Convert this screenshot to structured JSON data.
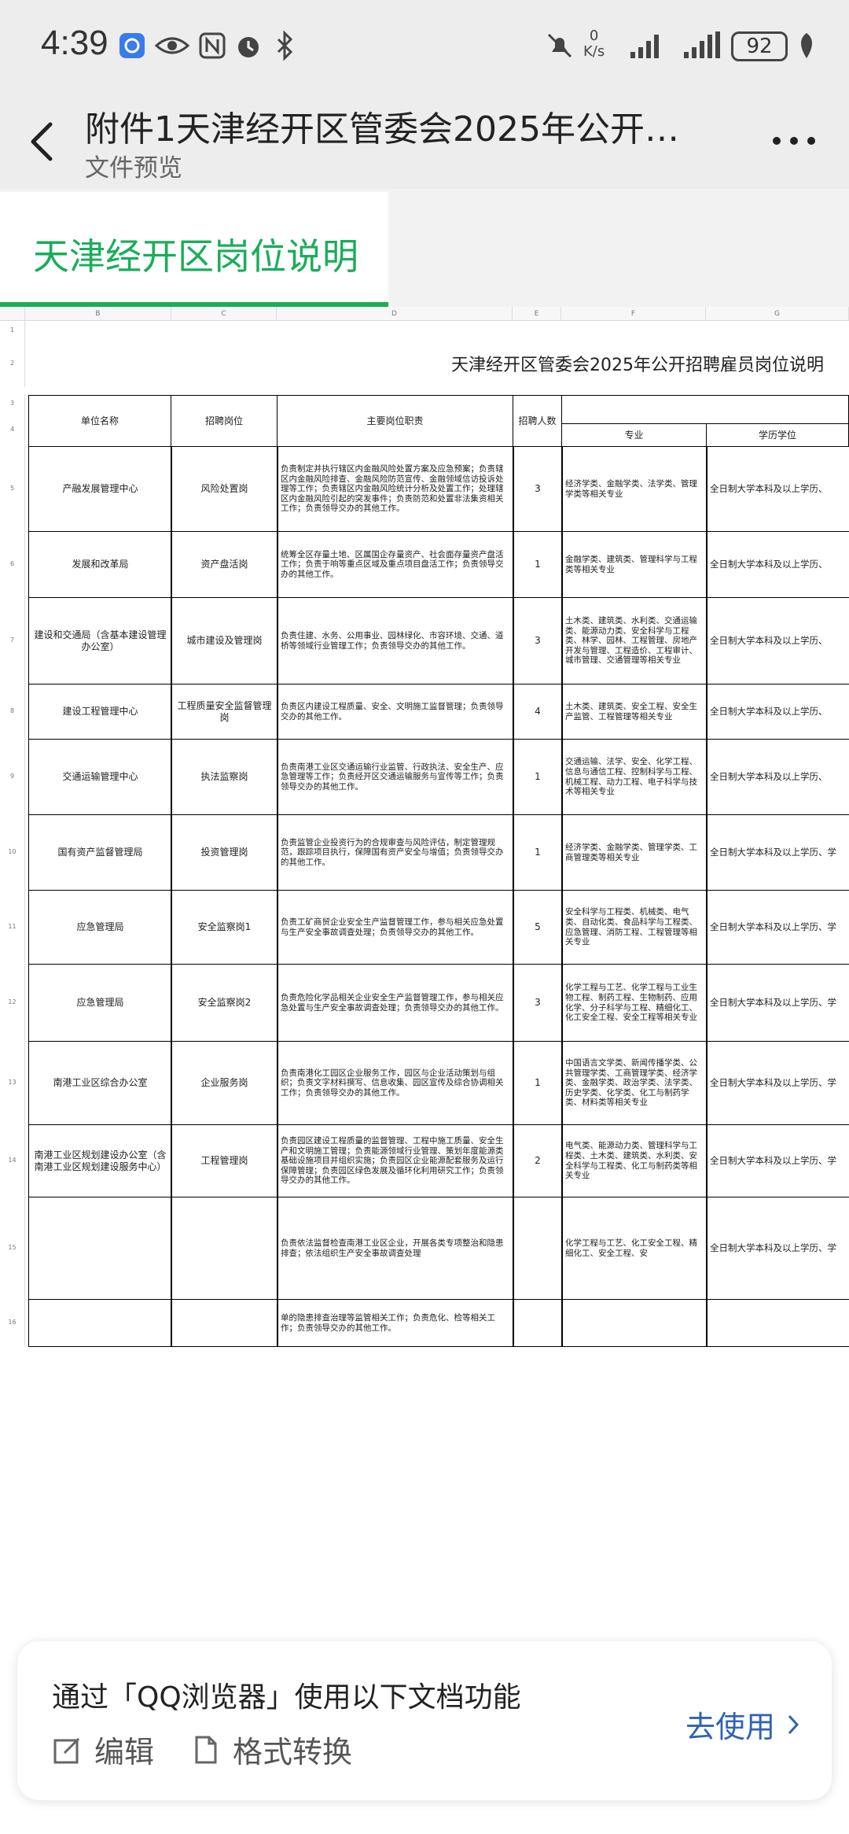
{
  "status_bar": {
    "time": "4:39",
    "net_speed": "0\nK/s",
    "battery": "92"
  },
  "header": {
    "title": "附件1天津经开区管委会2025年公开…",
    "subtitle": "文件预览",
    "more_label": "…"
  },
  "sheet_tab": {
    "label": "天津经开区岗位说明"
  },
  "spreadsheet": {
    "col_letters": [
      "B",
      "C",
      "D",
      "E",
      "F",
      "G"
    ],
    "sheet_title": "天津经开区管委会2025年公开招聘雇员岗位说明",
    "headers": {
      "unit": "单位名称",
      "position": "招聘岗位",
      "duties": "主要岗位职责",
      "count": "招聘人数",
      "major": "专业",
      "degree": "学历学位"
    },
    "rows": [
      {
        "num": "5",
        "unit": "产融发展管理中心",
        "position": "风险处置岗",
        "duties": "负责制定并执行辖区内金融风险处置方案及应急预案；负责辖区内金融风险排查、金融风险防范宣传、金融领域信访投诉处理等工作；负责辖区内金融风险统计分析及处置工作；处理辖区内金融风险引起的突发事件；负责防范和处置非法集资相关工作；负责领导交办的其他工作。",
        "count": "3",
        "major": "经济学类、金融学类、法学类、管理学类等相关专业",
        "degree": "全日制大学本科及以上学历、"
      },
      {
        "num": "6",
        "unit": "发展和改革局",
        "position": "资产盘活岗",
        "duties": "统筹全区存量土地、区属国企存量资产、社会面存量资产盘活工作；负责于响等重点区域及重点项目盘活工作；负责领导交办的其他工作。",
        "count": "1",
        "major": "金融学类、建筑类、管理科学与工程类等相关专业",
        "degree": "全日制大学本科及以上学历、"
      },
      {
        "num": "7",
        "unit": "建设和交通局（含基本建设管理办公室）",
        "position": "城市建设及管理岗",
        "duties": "负责住建、水务、公用事业、园林绿化、市容环境、交通、道桥等领域行业管理工作；负责领导交办的其他工作。",
        "count": "3",
        "major": "土木类、建筑类、水利类、交通运输类、能源动力类、安全科学与工程类、林学、园林、工程管理、房地产开发与管理、工程造价、工程审计、城市管理、交通管理等相关专业",
        "degree": "全日制大学本科及以上学历、"
      },
      {
        "num": "8",
        "unit": "建设工程管理中心",
        "position": "工程质量安全监督管理岗",
        "duties": "负责区内建设工程质量、安全、文明施工监督管理；负责领导交办的其他工作。",
        "count": "4",
        "major": "土木类、建筑类、安全工程、安全生产监管、工程管理等相关专业",
        "degree": "全日制大学本科及以上学历、"
      },
      {
        "num": "9",
        "unit": "交通运输管理中心",
        "position": "执法监察岗",
        "duties": "负责南港工业区交通运输行业监管、行政执法、安全生产、应急管理等工作；负责经开区交通运输服务与宣传等工作；负责领导交办的其他工作。",
        "count": "1",
        "major": "交通运输、法学、安全、化学工程、信息与通信工程、控制科学与工程、机械工程、动力工程、电子科学与技术等相关专业",
        "degree": "全日制大学本科及以上学历、"
      },
      {
        "num": "10",
        "unit": "国有资产监督管理局",
        "position": "投资管理岗",
        "duties": "负责监管企业投资行为的合规审查与风险评估，制定管理规范，跟踪项目执行，保障国有资产安全与增值；负责领导交办的其他工作。",
        "count": "1",
        "major": "经济学类、金融学类、管理学类、工商管理类等相关专业",
        "degree": "全日制大学本科及以上学历、学"
      },
      {
        "num": "11",
        "unit": "应急管理局",
        "position": "安全监察岗1",
        "duties": "负责工矿商贸企业安全生产监督管理工作，参与相关应急处置与生产安全事故调查处理；负责领导交办的其他工作。",
        "count": "5",
        "major": "安全科学与工程类、机械类、电气类、自动化类、食品科学与工程类、应急管理、消防工程、工程管理等相关专业",
        "degree": "全日制大学本科及以上学历、学"
      },
      {
        "num": "12",
        "unit": "应急管理局",
        "position": "安全监察岗2",
        "duties": "负责危险化学品相关企业安全生产监督管理工作，参与相关应急处置与生产安全事故调查处理；负责领导交办的其他工作。",
        "count": "3",
        "major": "化学工程与工艺、化学工程与工业生物工程、制药工程、生物制药、应用化学、分子科学与工程、精细化工、化工安全工程、安全工程等相关专业",
        "degree": "全日制大学本科及以上学历、学"
      },
      {
        "num": "13",
        "unit": "南港工业区综合办公室",
        "position": "企业服务岗",
        "duties": "负责南港化工园区企业服务工作，园区与企业活动策划与组织；负责文字材料撰写、信息收集、园区宣传及综合协调相关工作；负责领导交办的其他工作。",
        "count": "1",
        "major": "中国语言文学类、新闻传播学类、公共管理学类、工商管理学类、经济学类、金融学类、政治学类、法学类、历史学类、化学类、化工与制药学类、材料类等相关专业",
        "degree": "全日制大学本科及以上学历、学"
      },
      {
        "num": "14",
        "unit": "南港工业区规划建设办公室（含南港工业区规划建设服务中心）",
        "position": "工程管理岗",
        "duties": "负责园区建设工程质量的监督管理、工程中施工质量、安全生产和文明施工管理；负责能源领域行业管理、策划年度能源类基础设施项目并组织实施；负责园区企业能源配套服务及运行保障管理；负责园区绿色发展及循环化利用研究工作；负责领导交办的其他工作。",
        "count": "2",
        "major": "电气类、能源动力类、管理科学与工程类、土木类、建筑类、水利类、安全科学与工程类、化工与制药类等相关专业",
        "degree": "全日制大学本科及以上学历、学"
      },
      {
        "num": "15",
        "unit": "",
        "position": "",
        "duties": "负责依法监督检查南港工业区企业，开展各类专项整治和隐患排查；依法组织生产安全事故调查处理",
        "count": "",
        "major": "化学工程与工艺、化工安全工程、精细化工、安全工程、安",
        "degree": "全日制大学本科及以上学历、学"
      },
      {
        "num": "16",
        "unit": "",
        "position": "",
        "duties": "单的隐患排查治理等监管相关工作；负责危化、检等相关工作；负责领导交办的其他工作。",
        "count": "",
        "major": "",
        "degree": ""
      }
    ]
  },
  "banner": {
    "title": "通过「QQ浏览器」使用以下文档功能",
    "edit_label": "编辑",
    "convert_label": "格式转换",
    "cta_label": "去使用"
  },
  "colors": {
    "accent": "#1aad5a",
    "link": "#2f62b5"
  }
}
